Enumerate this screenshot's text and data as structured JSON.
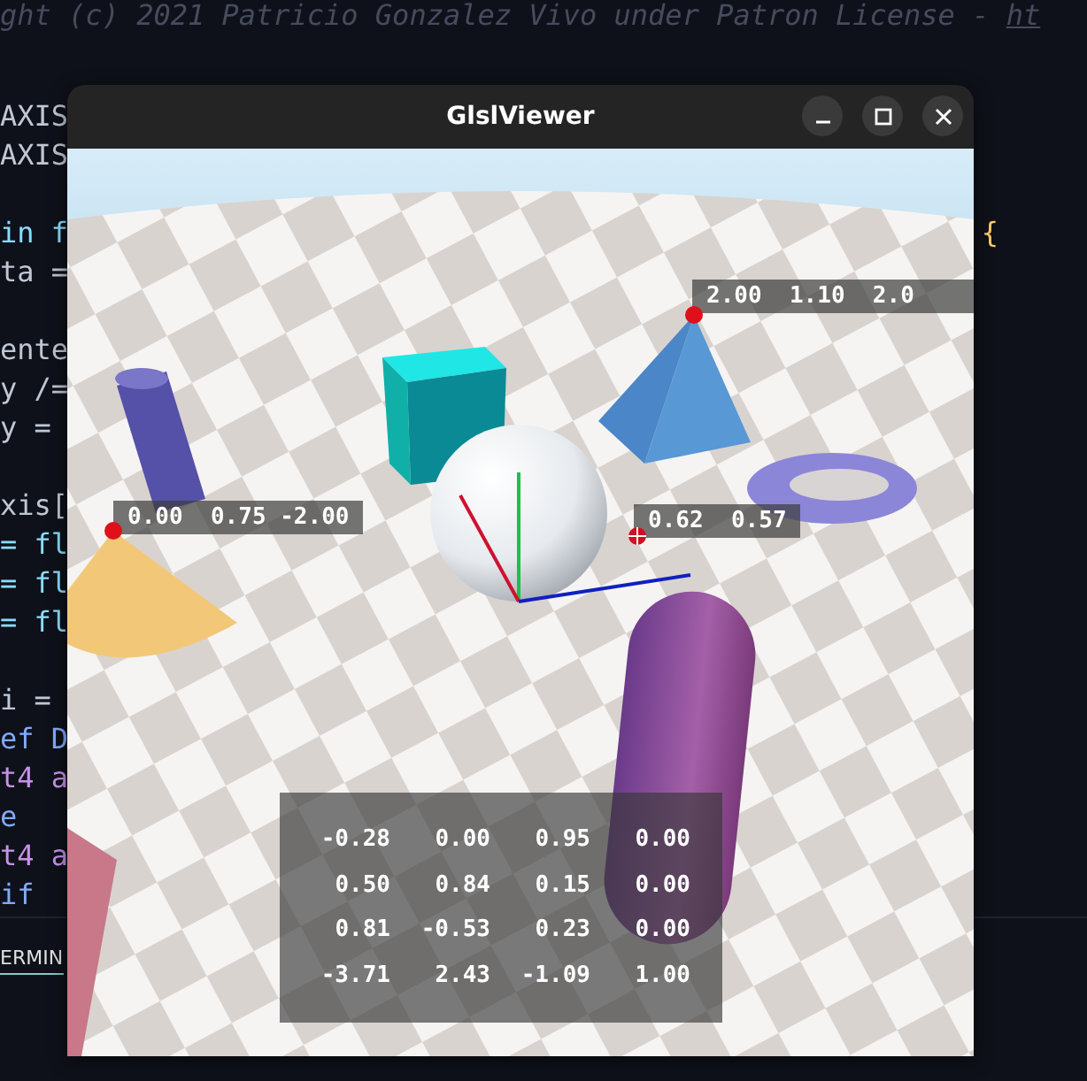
{
  "editor": {
    "header_comment": "ght (c) 2021 Patricio Gonzalez Vivo under Patron License - ",
    "header_link": "ht",
    "blocks": [
      [
        {
          "text": "AXIS",
          "kind": "plain"
        },
        {
          "text": "AXIS",
          "kind": "plain"
        }
      ],
      [
        {
          "text": "in f",
          "kind": "keyword",
          "trailing": "{"
        },
        {
          "text": "ta =",
          "kind": "plain"
        }
      ],
      [
        {
          "text": "ente",
          "kind": "plain"
        },
        {
          "text": "y /=",
          "kind": "plain"
        },
        {
          "text": "y =",
          "kind": "plain"
        }
      ],
      [
        {
          "text": "xis[",
          "kind": "plain"
        },
        {
          "text": "= fl",
          "kind": "keyword"
        },
        {
          "text": "= fl",
          "kind": "keyword"
        },
        {
          "text": "= fl",
          "kind": "keyword"
        }
      ],
      [
        {
          "text": "i =",
          "kind": "plain"
        },
        {
          "text": "ef D",
          "kind": "macro"
        },
        {
          "text": "t4 a",
          "kind": "type"
        },
        {
          "text": "e",
          "kind": "macro"
        },
        {
          "text": "t4 a",
          "kind": "type"
        },
        {
          "text": "if",
          "kind": "macro"
        }
      ]
    ],
    "panel_tab": "ERMIN"
  },
  "window": {
    "title": "GlslViewer"
  },
  "viewport": {
    "point_labels": [
      {
        "text": "2.00  1.10  2.0",
        "kind": "point"
      },
      {
        "text": "0.00  0.75 -2.00",
        "kind": "point"
      },
      {
        "text": "0.62  0.57",
        "kind": "cursor"
      }
    ],
    "matrix": [
      [
        "-0.28",
        "0.00",
        "0.95",
        "0.00"
      ],
      [
        "0.50",
        "0.84",
        "0.15",
        "0.00"
      ],
      [
        "0.81",
        "-0.53",
        "0.23",
        "0.00"
      ],
      [
        "-3.71",
        "2.43",
        "-1.09",
        "1.00"
      ]
    ]
  }
}
